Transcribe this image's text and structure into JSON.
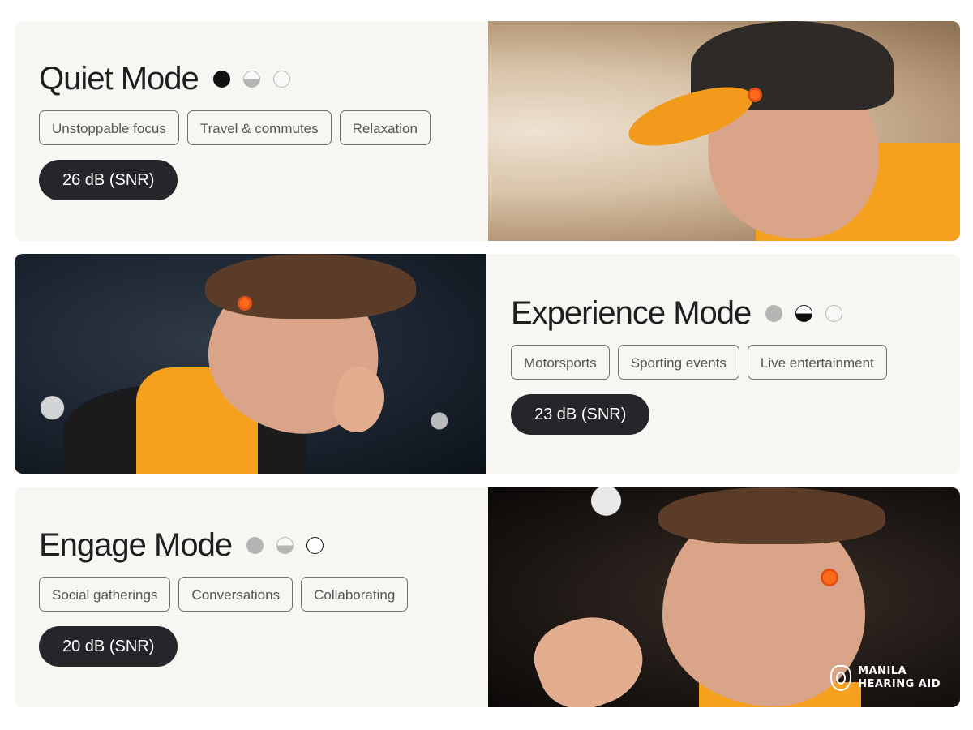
{
  "modes": [
    {
      "title": "Quiet Mode",
      "tags": [
        "Unstoppable focus",
        "Travel & commutes",
        "Relaxation"
      ],
      "snr": "26 dB (SNR)",
      "active_indicator": 1
    },
    {
      "title": "Experience Mode",
      "tags": [
        "Motorsports",
        "Sporting events",
        "Live entertainment"
      ],
      "snr": "23 dB (SNR)",
      "active_indicator": 2
    },
    {
      "title": "Engage Mode",
      "tags": [
        "Social gatherings",
        "Conversations",
        "Collaborating"
      ],
      "snr": "20 dB (SNR)",
      "active_indicator": 3
    }
  ],
  "logo": {
    "line1": "MANILA",
    "line2": "HEARING AID"
  },
  "colors": {
    "accent_orange": "#f6a11d",
    "pill_dark": "#26262a",
    "panel_bg": "#f8f6f3"
  },
  "icons": {
    "indicator_1": "filled-circle-icon",
    "indicator_2": "half-filled-circle-icon",
    "indicator_3": "empty-circle-icon"
  }
}
